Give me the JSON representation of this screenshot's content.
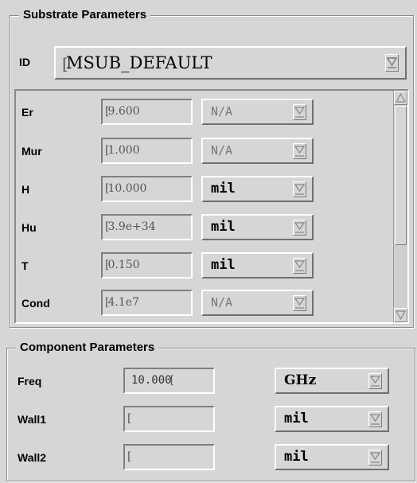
{
  "substrate": {
    "title": "Substrate Parameters",
    "id_label": "ID",
    "id_value": "MSUB_DEFAULT",
    "rows": [
      {
        "label": "Er",
        "value": "9.600",
        "unit": "N/A",
        "unit_enabled": false
      },
      {
        "label": "Mur",
        "value": "1.000",
        "unit": "N/A",
        "unit_enabled": false
      },
      {
        "label": "H",
        "value": "10.000",
        "unit": "mil",
        "unit_enabled": true
      },
      {
        "label": "Hu",
        "value": "3.9e+34",
        "unit": "mil",
        "unit_enabled": true
      },
      {
        "label": "T",
        "value": "0.150",
        "unit": "mil",
        "unit_enabled": true
      },
      {
        "label": "Cond",
        "value": "4.1e7",
        "unit": "N/A",
        "unit_enabled": false
      }
    ],
    "scroll_position": 0
  },
  "component": {
    "title": "Component Parameters",
    "rows": [
      {
        "label": "Freq",
        "value": "10.000",
        "unit": "GHz"
      },
      {
        "label": "Wall1",
        "value": "",
        "unit": "mil"
      },
      {
        "label": "Wall2",
        "value": "",
        "unit": "mil"
      }
    ]
  },
  "icons": {
    "dropdown": "dropdown-arrow-icon",
    "scroll_up": "scroll-up-arrow-icon",
    "scroll_down": "scroll-down-arrow-icon"
  }
}
